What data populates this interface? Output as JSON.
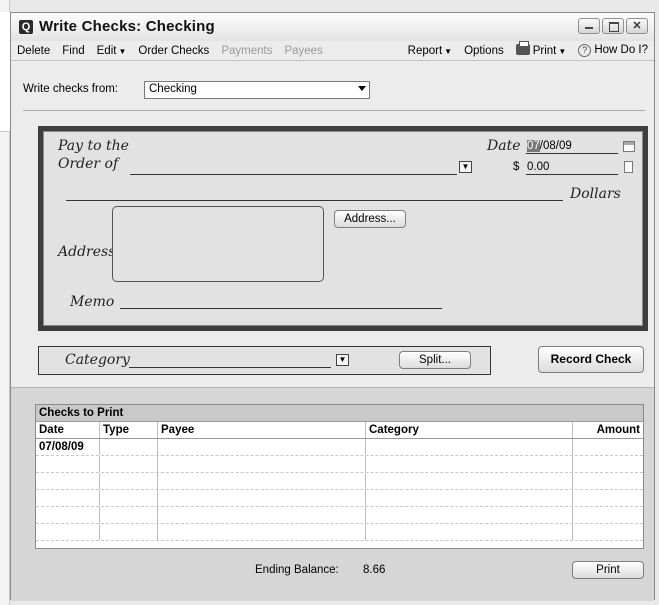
{
  "window": {
    "title": "Write Checks: Checking",
    "app_icon": "Q",
    "close_glyph": "✕"
  },
  "menu": {
    "delete": "Delete",
    "find": "Find",
    "edit": "Edit",
    "order_checks": "Order Checks",
    "payments": "Payments",
    "payees": "Payees",
    "report": "Report",
    "options": "Options",
    "print": "Print",
    "how_do_i": "How Do I?"
  },
  "form": {
    "write_from_label": "Write checks from:",
    "account_value": "Checking"
  },
  "check": {
    "pay_to_label_1": "Pay to the",
    "pay_to_label_2": "Order of",
    "date_label": "Date",
    "date_month": "07",
    "date_rest": "/08/09",
    "dollar_sign": "$",
    "amount": "0.00",
    "dollars_label": "Dollars",
    "address_label": "Address",
    "address_button": "Address...",
    "memo_label": "Memo"
  },
  "category": {
    "label": "Category",
    "split_button": "Split...",
    "record_button": "Record Check"
  },
  "checks_to_print": {
    "title": "Checks to Print",
    "columns": [
      "Date",
      "Type",
      "Payee",
      "Category",
      "Amount"
    ],
    "rows": [
      [
        "07/08/09",
        "",
        "",
        "",
        ""
      ],
      [
        "",
        "",
        "",
        "",
        ""
      ],
      [
        "",
        "",
        "",
        "",
        ""
      ],
      [
        "",
        "",
        "",
        "",
        ""
      ],
      [
        "",
        "",
        "",
        "",
        ""
      ],
      [
        "",
        "",
        "",
        "",
        ""
      ]
    ]
  },
  "footer": {
    "ending_balance_label": "Ending Balance:",
    "ending_balance_value": "8.66",
    "print_button": "Print"
  }
}
